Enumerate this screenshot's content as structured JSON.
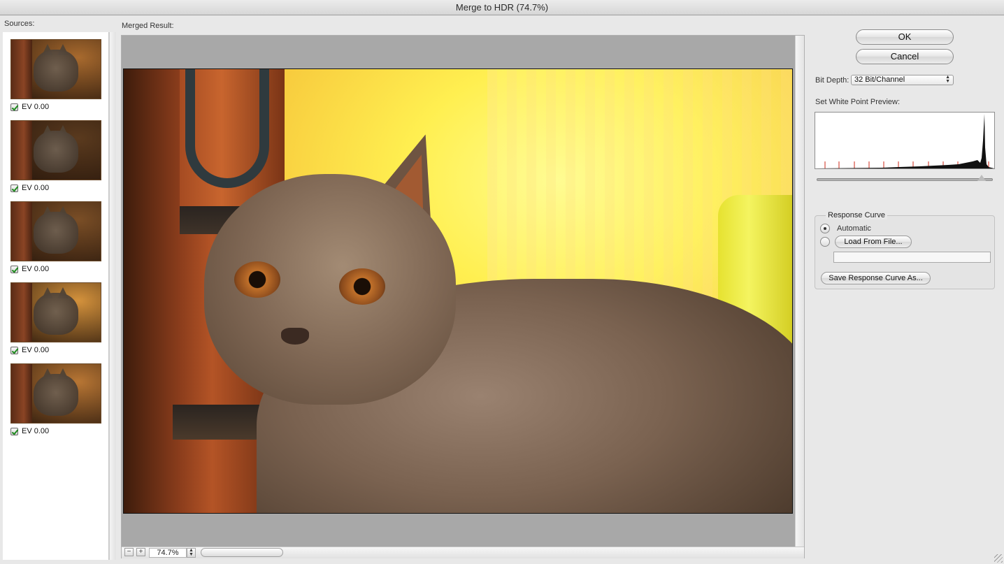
{
  "window": {
    "title": "Merge to HDR (74.7%)"
  },
  "sources": {
    "label": "Sources:",
    "items": [
      {
        "ev": "EV 0.00",
        "checked": true,
        "tone": "#a86a2e"
      },
      {
        "ev": "EV 0.00",
        "checked": true,
        "tone": "#5a3a1e"
      },
      {
        "ev": "EV 0.00",
        "checked": true,
        "tone": "#7a4e26"
      },
      {
        "ev": "EV 0.00",
        "checked": true,
        "tone": "#d4923c"
      },
      {
        "ev": "EV 0.00",
        "checked": true,
        "tone": "#b87634"
      }
    ]
  },
  "merged": {
    "label": "Merged Result:",
    "zoom_value": "74.7%",
    "zoom_out_icon": "minus-icon",
    "zoom_in_icon": "plus-icon"
  },
  "actions": {
    "ok_label": "OK",
    "cancel_label": "Cancel"
  },
  "bit_depth": {
    "label": "Bit Depth:",
    "value": "32 Bit/Channel"
  },
  "white_point": {
    "label": "Set White Point Preview:"
  },
  "response_curve": {
    "title": "Response Curve",
    "automatic_label": "Automatic",
    "automatic_selected": true,
    "load_label": "Load From File...",
    "file_path": "",
    "save_label": "Save Response Curve As..."
  },
  "colors": {
    "histogram_marker": "#cc2a1a"
  }
}
